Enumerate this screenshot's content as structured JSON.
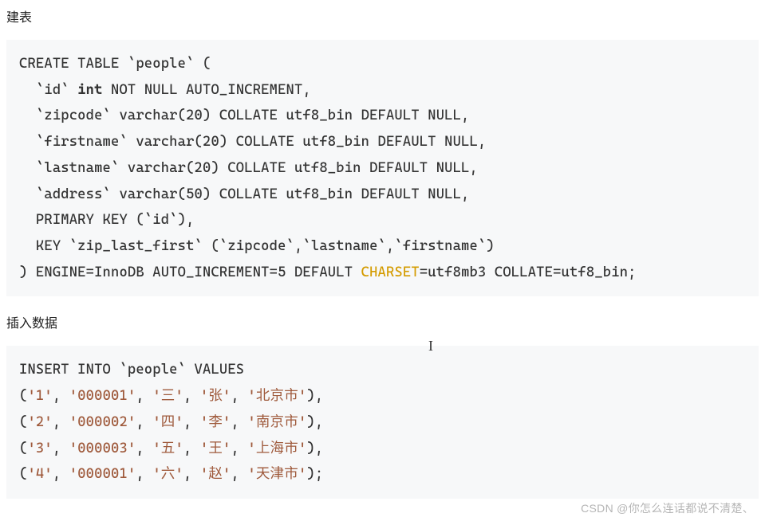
{
  "heading1": "建表",
  "code1": {
    "l1_pre": "CREATE TABLE `people` (",
    "l2_pre": "  `id` ",
    "l2_kw": "int",
    "l2_post": " NOT NULL AUTO_INCREMENT,",
    "l3": "  `zipcode` varchar(20) COLLATE utf8_bin DEFAULT NULL,",
    "l4": "  `firstname` varchar(20) COLLATE utf8_bin DEFAULT NULL,",
    "l5": "  `lastname` varchar(20) COLLATE utf8_bin DEFAULT NULL,",
    "l6": "  `address` varchar(50) COLLATE utf8_bin DEFAULT NULL,",
    "l7": "  PRIMARY KEY (`id`),",
    "l8": "  KEY `zip_last_first` (`zipcode`,`lastname`,`firstname`)",
    "l9_pre": ") ENGINE=InnoDB AUTO_INCREMENT=5 DEFAULT ",
    "l9_kw": "CHARSET",
    "l9_post": "=utf8mb3 COLLATE=utf8_bin;"
  },
  "heading2": "插入数据",
  "code2": {
    "l1": "INSERT INTO `people` VALUES",
    "rows": [
      {
        "vals": [
          "'1'",
          "'000001'",
          "'三'",
          "'张'",
          "'北京市'"
        ],
        "term": ","
      },
      {
        "vals": [
          "'2'",
          "'000002'",
          "'四'",
          "'李'",
          "'南京市'"
        ],
        "term": ","
      },
      {
        "vals": [
          "'3'",
          "'000003'",
          "'五'",
          "'王'",
          "'上海市'"
        ],
        "term": ","
      },
      {
        "vals": [
          "'4'",
          "'000001'",
          "'六'",
          "'赵'",
          "'天津市'"
        ],
        "term": ";"
      }
    ]
  },
  "watermark": "CSDN @你怎么连话都说不清楚、",
  "caret": "I"
}
